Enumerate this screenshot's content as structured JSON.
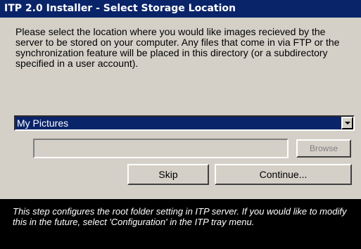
{
  "window": {
    "title": "ITP 2.0 Installer - Select Storage Location"
  },
  "message": "Please select the location where you would like images recieved by the server to be stored on your computer.  Any files that come in via FTP or the synchronization feature will be placed in this directory (or a subdirectory specified in a user account).",
  "location_select": {
    "selected": "My Pictures"
  },
  "path_input": {
    "value": "",
    "placeholder": ""
  },
  "buttons": {
    "browse": "Browse",
    "skip": "Skip",
    "continue": "Continue..."
  },
  "footer": {
    "text": "This step configures the root folder setting in ITP server.  If you would like to modify this in the future, select 'Configuration' in the ITP tray menu."
  },
  "colors": {
    "titlebar": "#0a246a",
    "dialog_bg": "#d4d0c8",
    "selection": "#0a246a",
    "footer_bg": "#000000",
    "disabled_text": "#808080"
  },
  "icons": {
    "dropdown_arrow": "chevron-down-icon"
  }
}
